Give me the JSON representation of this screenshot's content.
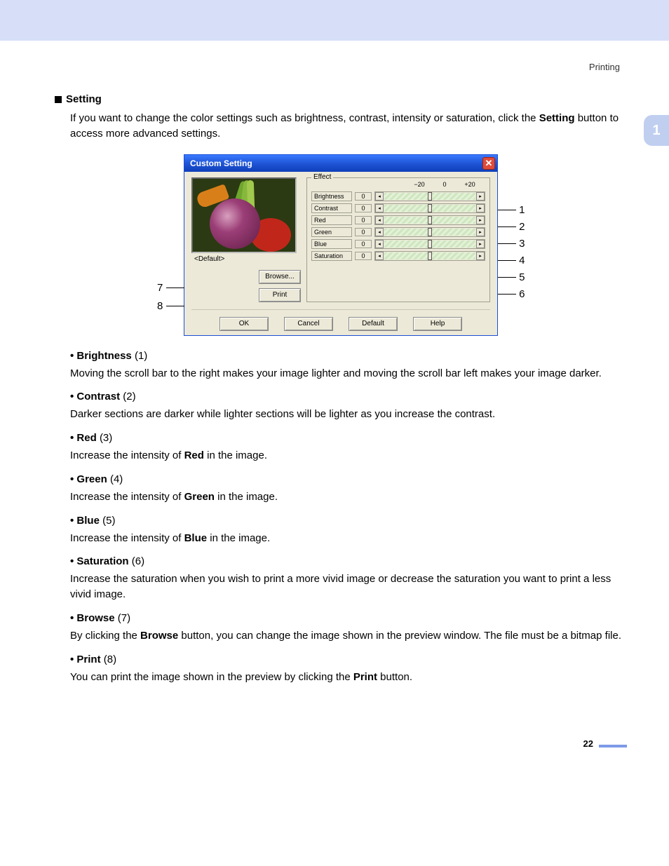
{
  "header": {
    "section": "Printing"
  },
  "sideTab": "1",
  "title": "Setting",
  "intro_a": "If you want to change the color settings such as brightness, contrast, intensity or saturation, click the ",
  "intro_b": "Setting",
  "intro_c": " button to access more advanced settings.",
  "dialog": {
    "title": "Custom Setting",
    "defaultLabel": "<Default>",
    "effectLegend": "Effect",
    "scale": {
      "lo": "−20",
      "mid": "0",
      "hi": "+20"
    },
    "rows": {
      "brightness": {
        "label": "Brightness",
        "value": "0"
      },
      "contrast": {
        "label": "Contrast",
        "value": "0"
      },
      "red": {
        "label": "Red",
        "value": "0"
      },
      "green": {
        "label": "Green",
        "value": "0"
      },
      "blue": {
        "label": "Blue",
        "value": "0"
      },
      "saturation": {
        "label": "Saturation",
        "value": "0"
      }
    },
    "buttons": {
      "browse": "Browse...",
      "print": "Print",
      "ok": "OK",
      "cancel": "Cancel",
      "default": "Default",
      "help": "Help"
    }
  },
  "callouts": {
    "c1": "1",
    "c2": "2",
    "c3": "3",
    "c4": "4",
    "c5": "5",
    "c6": "6",
    "c7": "7",
    "c8": "8"
  },
  "items": {
    "brightness": {
      "head": "Brightness",
      "num": "(1)",
      "body": "Moving the scroll bar to the right makes your image lighter and moving the scroll bar left makes your image darker."
    },
    "contrast": {
      "head": "Contrast",
      "num": "(2)",
      "body": "Darker sections are darker while lighter sections will be lighter as you increase the contrast."
    },
    "red": {
      "head": "Red",
      "num": "(3)",
      "body_a": "Increase the intensity of ",
      "body_bold": "Red",
      "body_b": " in the image."
    },
    "green": {
      "head": "Green",
      "num": "(4)",
      "body_a": "Increase the intensity of ",
      "body_bold": "Green",
      "body_b": " in the image."
    },
    "blue": {
      "head": "Blue",
      "num": "(5)",
      "body_a": "Increase the intensity of ",
      "body_bold": "Blue",
      "body_b": " in the image."
    },
    "saturation": {
      "head": "Saturation",
      "num": "(6)",
      "body": "Increase the saturation when you wish to print a more vivid image or decrease the saturation you want to print a less vivid image."
    },
    "browse": {
      "head": "Browse",
      "num": "(7)",
      "body_a": "By clicking the ",
      "body_bold": "Browse",
      "body_b": " button, you can change the image shown in the preview window. The file must be a bitmap file."
    },
    "print": {
      "head": "Print",
      "num": "(8)",
      "body_a": "You can print the image shown in the preview by clicking the ",
      "body_bold": "Print",
      "body_b": " button."
    }
  },
  "pageNumber": "22"
}
